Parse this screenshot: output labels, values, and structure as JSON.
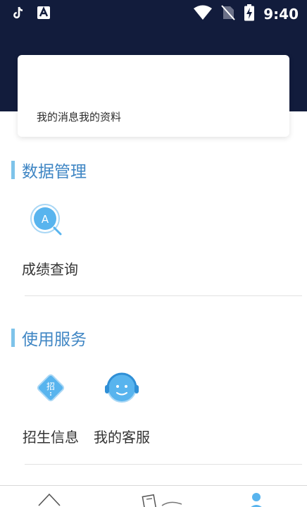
{
  "status_bar": {
    "time": "9:40",
    "icons": [
      "tiktok-icon",
      "text-app-icon",
      "wifi-icon",
      "no-sim-icon",
      "battery-charging-icon"
    ]
  },
  "profile_card": {
    "links": [
      "我的消息",
      "我的资料"
    ]
  },
  "sections": [
    {
      "title": "数据管理",
      "items": [
        {
          "label": "成绩查询",
          "icon": "score-search-icon"
        }
      ]
    },
    {
      "title": "使用服务",
      "items": [
        {
          "label": "招生信息",
          "icon": "admissions-icon"
        },
        {
          "label": "我的客服",
          "icon": "customer-service-icon"
        }
      ]
    }
  ],
  "icon_glyphs": {
    "score_search": "A",
    "admissions": "招"
  },
  "bottom_nav": {
    "items": [
      "home-icon",
      "news-icon",
      "profile-icon"
    ]
  },
  "colors": {
    "header": "#121c3c",
    "accent_bar": "#7ec3ea",
    "section_title": "#3f86c4",
    "icon_blue": "#58b4ee"
  }
}
